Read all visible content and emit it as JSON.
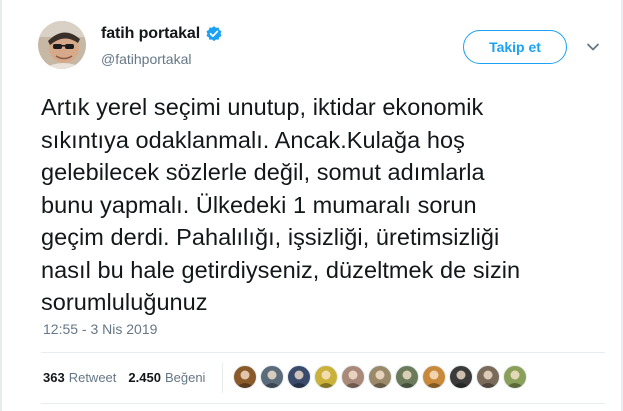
{
  "user": {
    "display_name": "fatih portakal",
    "handle": "@fatihportakal",
    "verified": true
  },
  "follow_label": "Takip et",
  "tweet": {
    "text": "Artık yerel seçimi unutup, iktidar ekonomik\nsıkıntıya odaklanmalı. Ancak.Kulağa hoş\ngelebilecek sözlerle değil, somut adımlarla\nbunu yapmalı. Ülkedeki 1 mumaralı sorun\ngeçim derdi. Pahalılığı, işsizliği, üretimsizliği\nnasıl bu hale getirdiyseniz, düzeltmek de sizin\nsorumluluğunuz",
    "timestamp": "12:55 - 3 Nis 2019"
  },
  "stats": {
    "retweets": "363",
    "retweets_label": "Retweet",
    "likes": "2.450",
    "likes_label": "Beğeni"
  },
  "colors": {
    "accent": "#1da1f2",
    "text": "#14171a",
    "muted": "#657786"
  },
  "liker_avatars": [
    {
      "icon": "user-avatar-icon",
      "color": "#8a5a2b"
    },
    {
      "icon": "user-avatar-icon",
      "color": "#5b6b7a"
    },
    {
      "icon": "user-avatar-icon",
      "color": "#3a4a6b"
    },
    {
      "icon": "user-avatar-icon",
      "color": "#c9b13a"
    },
    {
      "icon": "user-avatar-icon",
      "color": "#a98a7a"
    },
    {
      "icon": "user-avatar-icon",
      "color": "#9a8a6a"
    },
    {
      "icon": "user-avatar-icon",
      "color": "#6b7a5a"
    },
    {
      "icon": "user-avatar-icon",
      "color": "#c88a3a"
    },
    {
      "icon": "user-avatar-icon",
      "color": "#3a3a3a"
    },
    {
      "icon": "user-avatar-icon",
      "color": "#7a6a5a"
    },
    {
      "icon": "user-avatar-icon",
      "color": "#8aa05a"
    }
  ]
}
